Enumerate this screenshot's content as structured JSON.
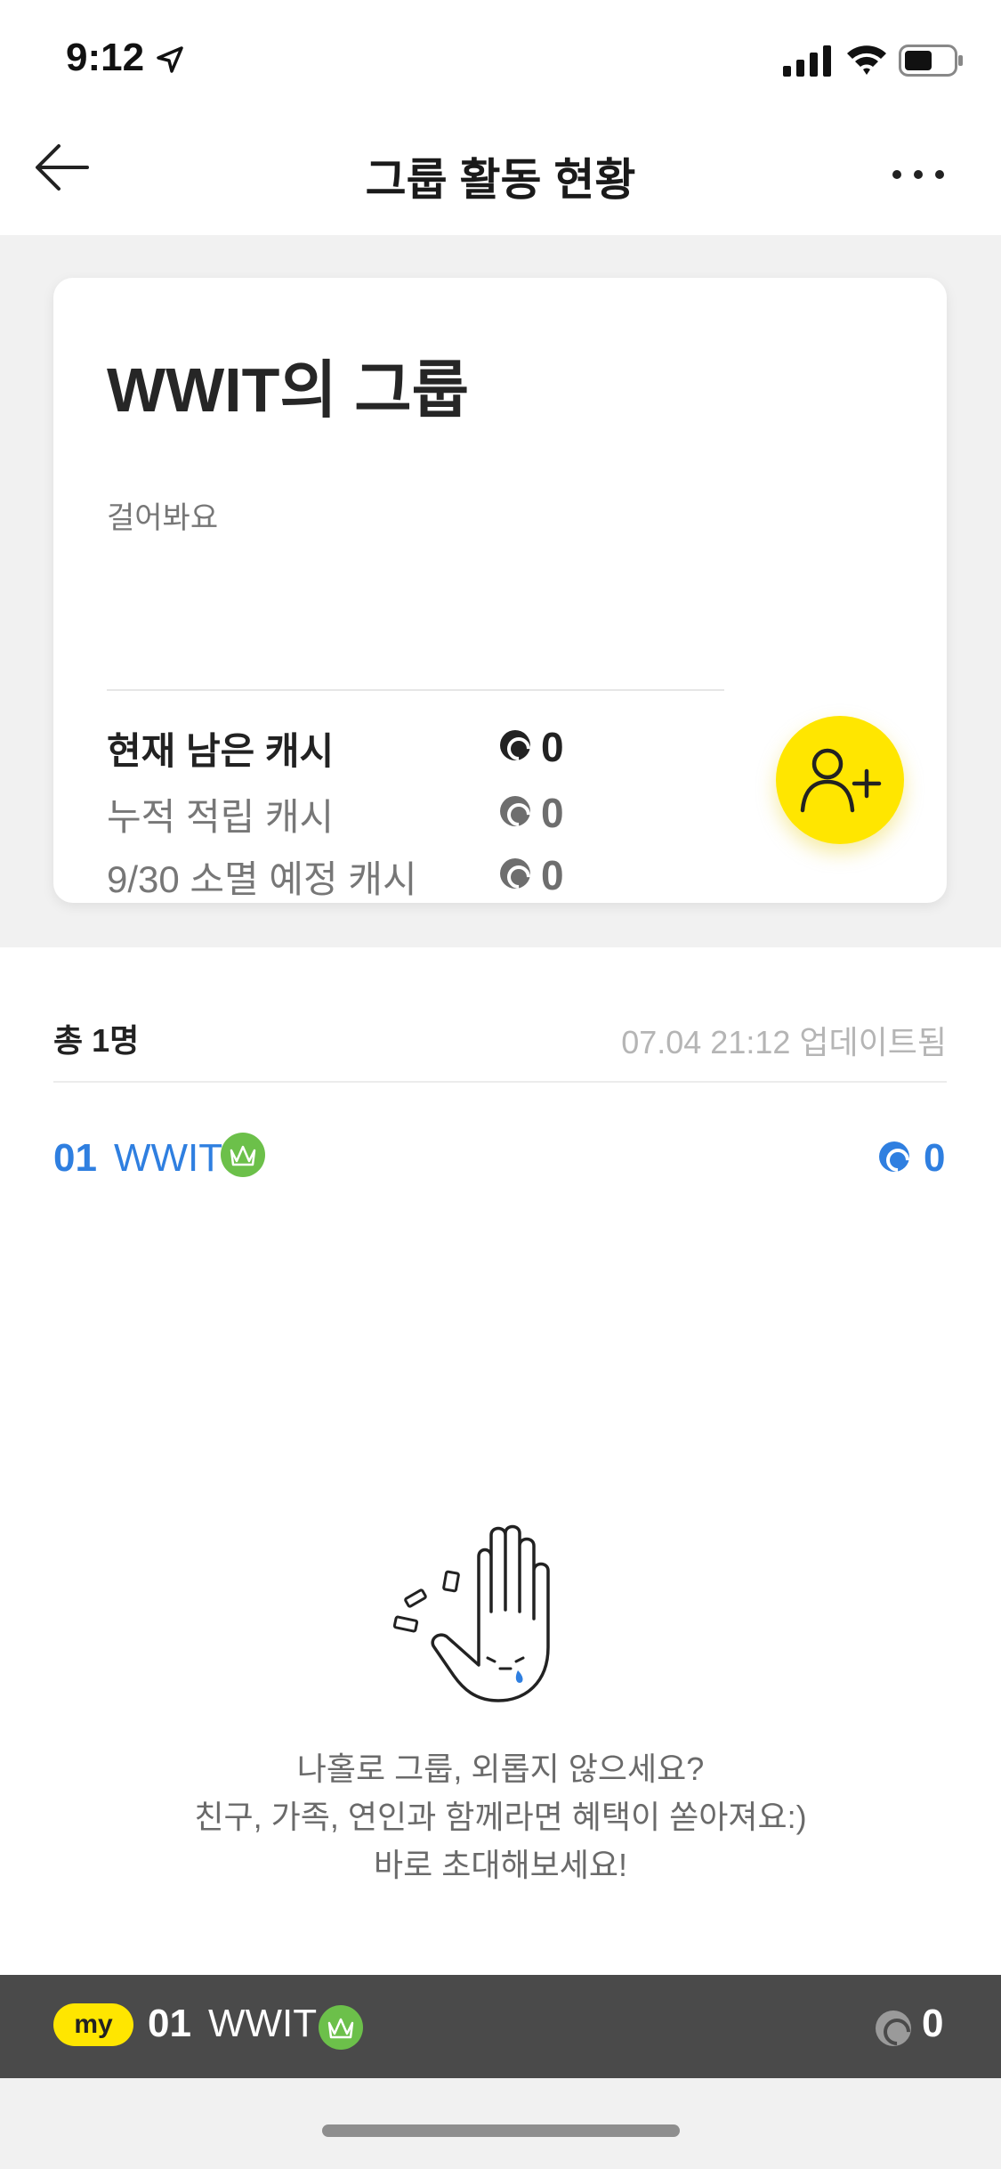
{
  "status_bar": {
    "time": "9:12",
    "icons": [
      "location-arrow-icon",
      "cellular-signal-icon",
      "wifi-icon",
      "battery-icon"
    ]
  },
  "nav": {
    "title": "그룹 활동 현황",
    "back_icon": "arrow-left-icon",
    "more_icon": "more-dots-icon"
  },
  "group": {
    "name": "WWIT의 그룹",
    "description": "걸어봐요",
    "cash": [
      {
        "label": "현재 남은 캐시",
        "value": "0",
        "emphasis": true
      },
      {
        "label": "누적 적립 캐시",
        "value": "0",
        "emphasis": false
      },
      {
        "label": "9/30 소멸 예정 캐시",
        "value": "0",
        "emphasis": false
      }
    ],
    "invite_icon": "add-user-icon"
  },
  "members": {
    "total": "총 1명",
    "updated": "07.04 21:12 업데이트됨",
    "list": [
      {
        "rank": "01",
        "name": "WWIT",
        "badge": "crown-icon",
        "value": "0"
      }
    ]
  },
  "empty_state": {
    "illustration": "sad-hand-icon",
    "lines": [
      "나홀로 그룹, 외롭지 않으세요?",
      "친구, 가족, 연인과 함께라면 혜택이 쏟아져요:)",
      "바로 초대해보세요!"
    ]
  },
  "my_bar": {
    "badge": "my",
    "rank": "01",
    "name": "WWIT",
    "value": "0"
  },
  "colors": {
    "accent_yellow": "#ffe600",
    "rank_blue": "#2f7fe0",
    "crown_green": "#6cc04a",
    "my_bar_bg": "#4a4a4a"
  }
}
